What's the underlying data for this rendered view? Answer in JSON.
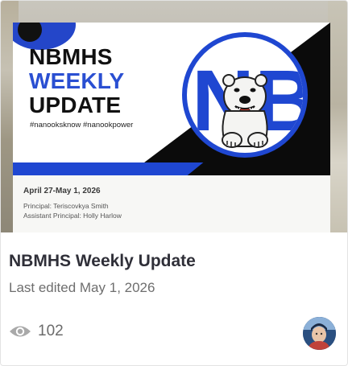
{
  "card": {
    "title": "NBMHS Weekly Update",
    "subtitle": "Last edited May 1, 2026",
    "view_count": "102",
    "view_icon": "eye-icon"
  },
  "thumbnail": {
    "title_line1": "NBMHS",
    "title_line2": "WEEKLY",
    "title_line3": "UPDATE",
    "hashtags": "#nanooksknow #nanookpower",
    "logo_letters": "NB",
    "logo_icon": "polar-bear-mascot",
    "dates": "April 27-May 1, 2026",
    "principal": "Principal: Teriscovkya Smith",
    "assistant_principal": "Assistant Principal: Holly Harlow"
  },
  "colors": {
    "accent_blue": "#1f47d1",
    "title_text": "#2f2f38",
    "muted_text": "#6e6e6e"
  }
}
